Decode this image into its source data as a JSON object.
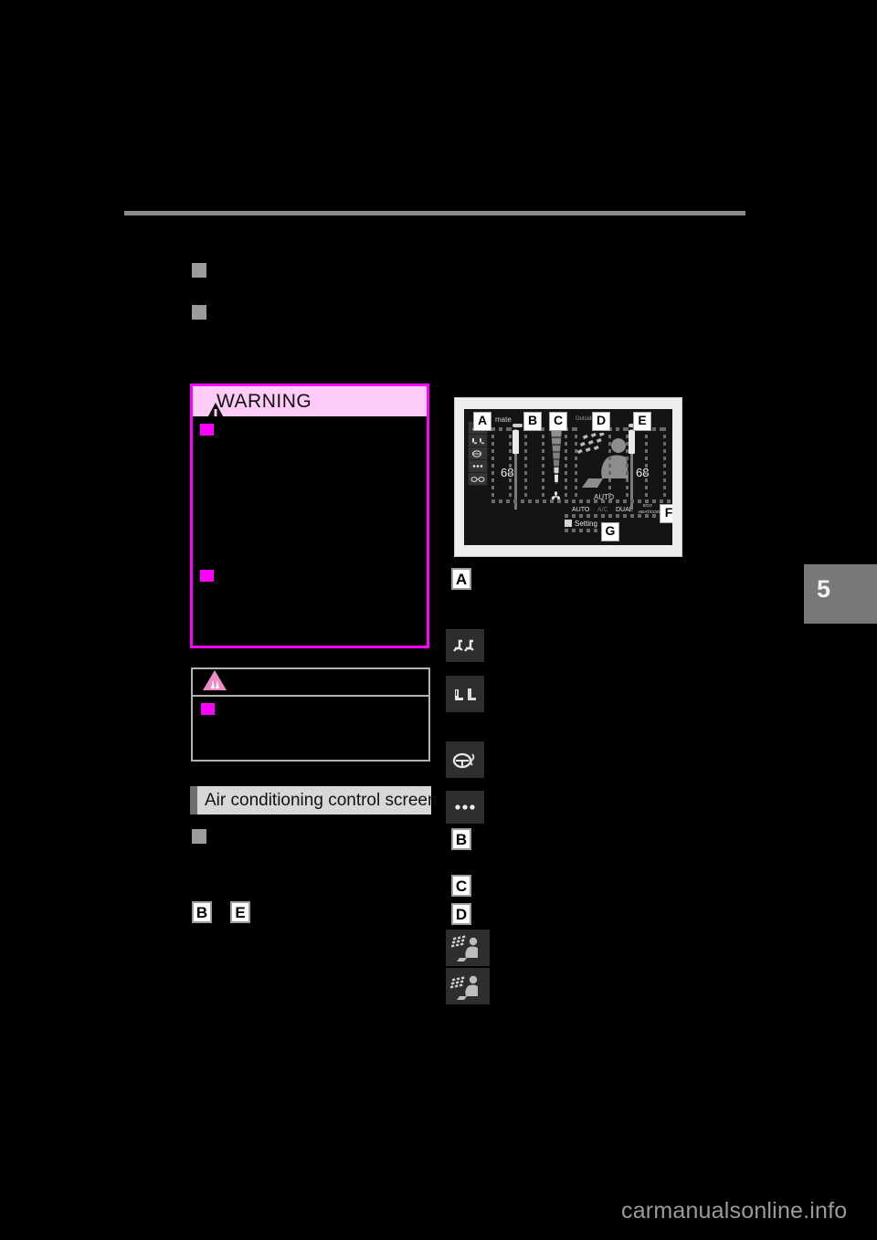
{
  "page": {
    "chapter_number": "5",
    "watermark": "carmanualsonline.info"
  },
  "warning_box": {
    "title": "WARNING",
    "icon": "warning-triangle-icon",
    "border_color": "#ff00ff",
    "header_bg": "#ffccf7",
    "bullets": [
      "",
      ""
    ]
  },
  "notice_box": {
    "icon": "notice-triangle-icon",
    "border_color": "#b3b3b3",
    "bullets": [
      ""
    ]
  },
  "section": {
    "header": "Air conditioning control screen",
    "bullet": "",
    "inline_callouts": [
      "B",
      "E"
    ]
  },
  "top_bullets": [
    "",
    ""
  ],
  "legend": {
    "items": [
      {
        "letter": "A",
        "icon": null
      },
      {
        "letter": null,
        "icon": "seat-airflow-icon"
      },
      {
        "letter": null,
        "icon": "seat-heater-icon"
      },
      {
        "letter": null,
        "icon": "steering-heater-icon"
      },
      {
        "letter": null,
        "icon": "more-dots-icon"
      },
      {
        "letter": "B",
        "icon": null
      },
      {
        "letter": "C",
        "icon": null
      },
      {
        "letter": "D",
        "icon": null
      },
      {
        "letter": null,
        "icon": "airflow-upper-icon"
      },
      {
        "letter": null,
        "icon": "airflow-lower-icon"
      }
    ]
  },
  "ac_screen": {
    "title": "mate",
    "outside_label": "Outside",
    "temp_left": "68",
    "temp_right": "68",
    "auto_label": "AUTO",
    "buttons": [
      {
        "label": "AUTO",
        "state": "on"
      },
      {
        "label": "A/C",
        "state": "off"
      },
      {
        "label": "DUAL",
        "state": "on"
      },
      {
        "label": "ECO",
        "state": "on"
      },
      {
        "label": "HEAT/COOL",
        "state": "on"
      }
    ],
    "setting_label": "Setting",
    "fan_icon": "fan-icon",
    "defogger_icon": "rear-defogger-icon",
    "occupant_icon": "seat-occupant-airflow-icon",
    "callouts": [
      "A",
      "B",
      "C",
      "D",
      "E",
      "F",
      "G"
    ]
  }
}
